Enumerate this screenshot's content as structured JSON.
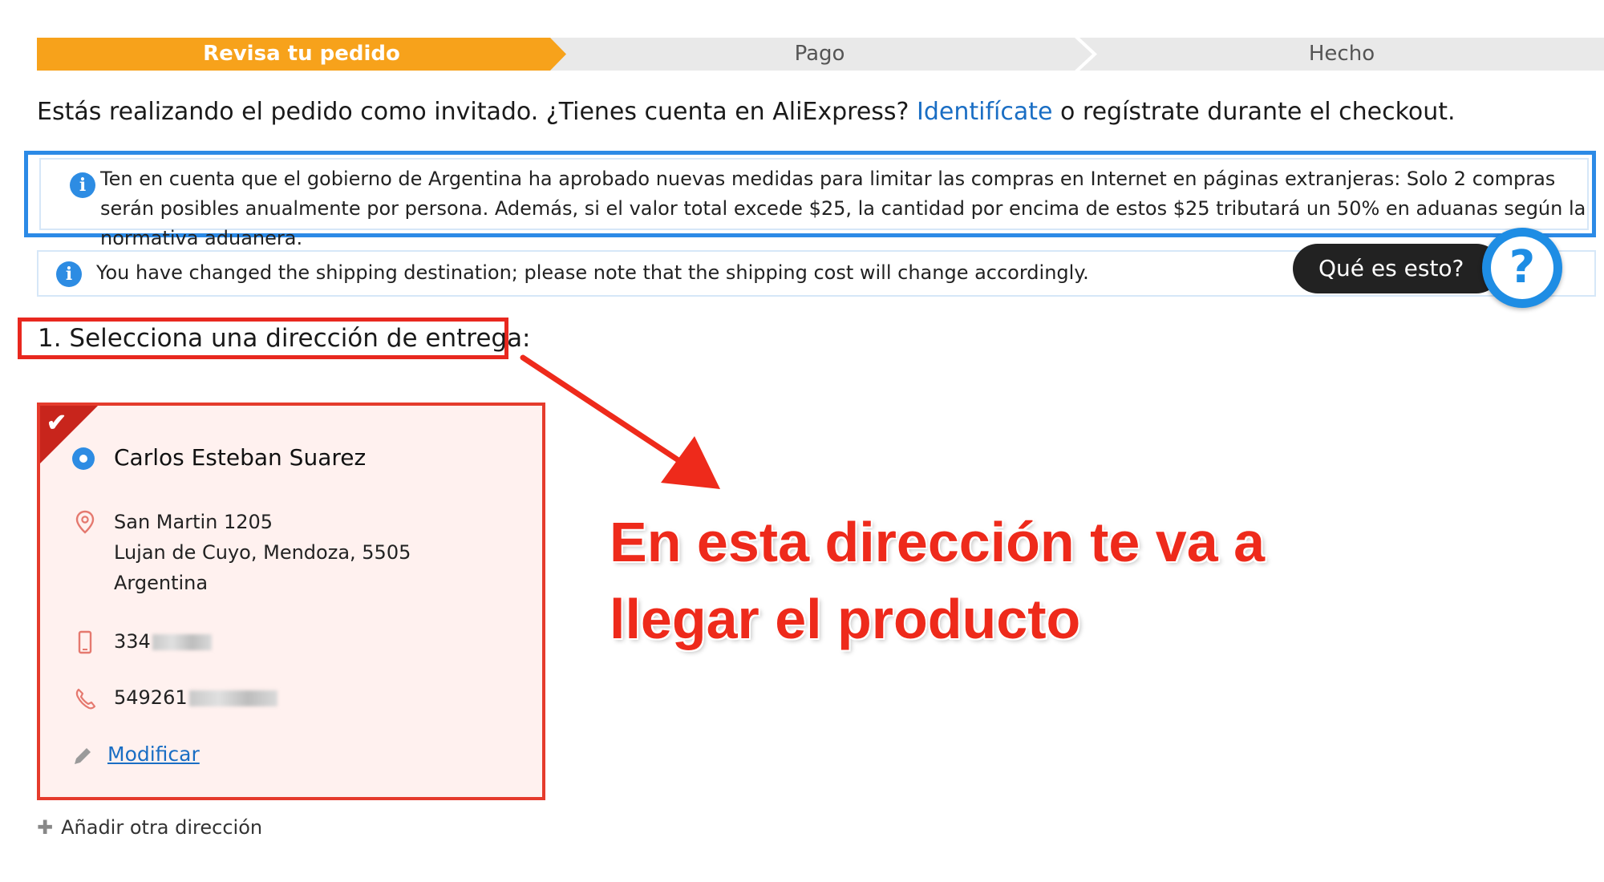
{
  "steps": [
    "Revisa tu pedido",
    "Pago",
    "Hecho"
  ],
  "guest": {
    "before": "Estás realizando el pedido como invitado. ¿Tienes cuenta en AliExpress? ",
    "link": "Identifícate",
    "after": " o regístrate durante el checkout."
  },
  "notices": {
    "argentina": "Ten en cuenta que el gobierno de Argentina ha aprobado nuevas medidas para limitar las compras en Internet en páginas extranjeras: Solo 2 compras serán posibles anualmente por persona. Además, si el valor total excede $25, la cantidad por encima de estos $25 tributará un 50% en aduanas según la normativa aduanera.",
    "shipping": "You have changed the shipping destination; please note that the shipping cost will change accordingly."
  },
  "help": {
    "label": "Qué es esto?",
    "symbol": "?"
  },
  "section_title": "1. Selecciona una dirección de entrega:",
  "address": {
    "name": "Carlos Esteban Suarez",
    "line1": "San Martin 1205",
    "line2": "Lujan de Cuyo, Mendoza, 5505",
    "line3": "Argentina",
    "mobile": "334",
    "phone": "549261",
    "modify": "Modificar"
  },
  "add_address": "Añadir otra dirección",
  "annotation": {
    "line1": "En esta dirección te va a",
    "line2": "llegar el producto"
  },
  "colors": {
    "active_step": "#f7a21b",
    "link": "#1a6ec4",
    "info": "#2d8ce3",
    "highlight_red": "#e8281f"
  }
}
